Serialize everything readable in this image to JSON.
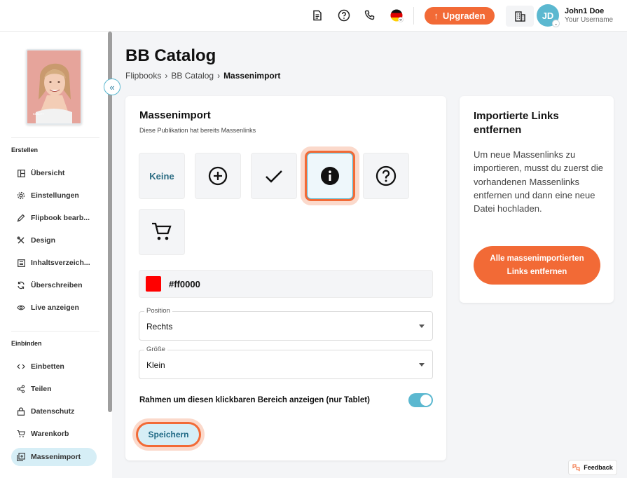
{
  "header": {
    "upgrade_label": "Upgraden",
    "avatar_initials": "JD",
    "user_name": "John1 Doe",
    "user_subtitle": "Your Username"
  },
  "sidebar": {
    "sections": [
      {
        "title": "Erstellen",
        "items": [
          {
            "label": "Übersicht",
            "icon": "layout-icon"
          },
          {
            "label": "Einstellungen",
            "icon": "gear-icon"
          },
          {
            "label": "Flipbook bearb...",
            "icon": "pencil-icon"
          },
          {
            "label": "Design",
            "icon": "tools-icon"
          },
          {
            "label": "Inhaltsverzeich...",
            "icon": "list-icon"
          },
          {
            "label": "Überschreiben",
            "icon": "refresh-icon"
          },
          {
            "label": "Live anzeigen",
            "icon": "eye-icon"
          }
        ]
      },
      {
        "title": "Einbinden",
        "items": [
          {
            "label": "Einbetten",
            "icon": "code-icon"
          },
          {
            "label": "Teilen",
            "icon": "share-icon"
          },
          {
            "label": "Datenschutz",
            "icon": "lock-icon"
          },
          {
            "label": "Warenkorb",
            "icon": "cart-icon"
          },
          {
            "label": "Massenimport",
            "icon": "import-icon",
            "active": true
          }
        ]
      }
    ]
  },
  "page": {
    "title": "BB Catalog",
    "breadcrumb": [
      "Flipbooks",
      "BB Catalog",
      "Massenimport"
    ]
  },
  "mass_import": {
    "heading": "Massenimport",
    "subtitle": "Diese Publikation hat bereits Massenlinks",
    "icon_options": [
      {
        "label": "Keine",
        "icon": "none"
      },
      {
        "label": "",
        "icon": "plus-circle-icon"
      },
      {
        "label": "",
        "icon": "check-icon"
      },
      {
        "label": "",
        "icon": "info-icon",
        "selected": true
      },
      {
        "label": "",
        "icon": "question-icon"
      },
      {
        "label": "",
        "icon": "cart-icon"
      }
    ],
    "color_value": "#ff0000",
    "position": {
      "label": "Position",
      "value": "Rechts"
    },
    "size": {
      "label": "Größe",
      "value": "Klein"
    },
    "toggle_label": "Rahmen um diesen klickbaren Bereich anzeigen (nur Tablet)",
    "toggle_on": true,
    "save_label": "Speichern"
  },
  "remove_card": {
    "heading_line1": "Importierte Links",
    "heading_line2": "entfernen",
    "text": "Um neue Massenlinks zu importieren, musst du zuerst die vorhandenen Massenlinks entfernen und dann eine neue Datei hochladen.",
    "button_line1": "Alle massenimportierten",
    "button_line2": "Links entfernen"
  },
  "feedback_label": "Feedback",
  "colors": {
    "accent": "#f26a36",
    "teal": "#5bb8d0",
    "active_bg": "#d6eef6",
    "swatch": "#ff0000"
  }
}
